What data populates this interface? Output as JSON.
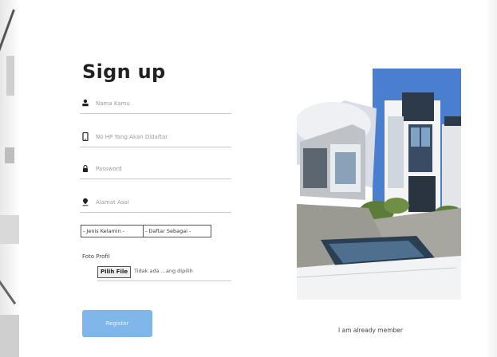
{
  "form": {
    "title": "Sign up",
    "fields": {
      "name_placeholder": "Nama Kamu",
      "phone_placeholder": "No HP Yang Akan Didaftar",
      "password_placeholder": "Password",
      "address_placeholder": "Alamat Asal"
    },
    "gender_select": "- Jenis Kelamin -",
    "role_select": "- Daftar Sebagai -",
    "photo_label": "Foto Profil",
    "file_button": "Pilih File",
    "file_status": "Tidak ada ...ang dipilih",
    "register_label": "Register"
  },
  "link": {
    "member_text": "I am already member"
  },
  "icons": {
    "name": "user-icon",
    "phone": "phone-icon",
    "password": "lock-icon",
    "address": "location-icon"
  },
  "colors": {
    "register_button": "#7fb7ea",
    "field_underline": "#c8c8c8",
    "title": "#222222"
  }
}
